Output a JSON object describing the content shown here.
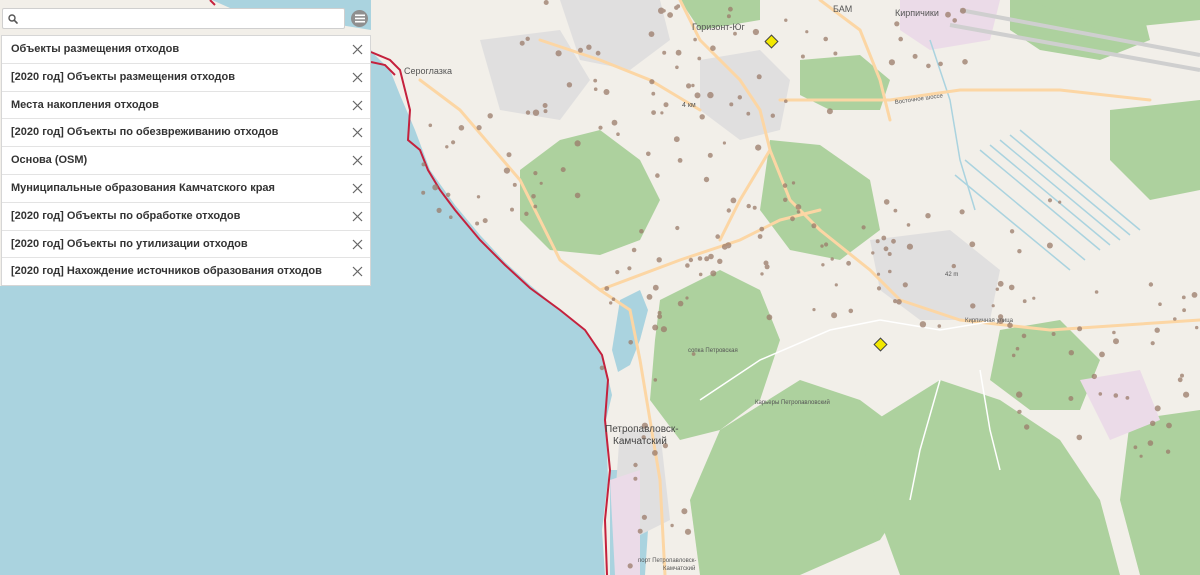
{
  "search": {
    "placeholder": ""
  },
  "layers": [
    {
      "label": "Объекты размещения отходов"
    },
    {
      "label": "[2020 год] Объекты размещения отходов"
    },
    {
      "label": "Места накопления отходов"
    },
    {
      "label": "[2020 год] Объекты по обезвреживанию отходов"
    },
    {
      "label": "Основа (OSM)"
    },
    {
      "label": "Муниципальные образования Камчатского края"
    },
    {
      "label": "[2020 год] Объекты по обработке отходов"
    },
    {
      "label": "[2020 год] Объекты по утилизации отходов"
    },
    {
      "label": "[2020 год] Нахождение источников образования отходов"
    }
  ],
  "map": {
    "labels": {
      "seroglazka": "Сероглазка",
      "gorizont_yug": "Горизонт-Юг",
      "bam": "БАМ",
      "kirpichiki": "Кирпичики",
      "petropavlovsk_1": "Петропавловск-",
      "petropavlovsk_2": "Камчатский",
      "vostochnoe_shosse": "Восточное шоссе",
      "sopka_petrovskaya": "сопка Петровская",
      "port_1": "порт Петропавловск-",
      "port_2": "Камчатский",
      "karery": "Карьеры Петропавловский",
      "kirpichnaya": "Кирпичная улица",
      "marker_height": "42 m",
      "a_km": "4 км"
    },
    "colors": {
      "water": "#aad3df",
      "forest": "#add19e",
      "land": "#f2efe9",
      "residential": "#e0dfdf",
      "industrial": "#ebdbe8",
      "road_major": "#fcd6a4",
      "boundary": "#c4213d",
      "building": "#9b7b6a",
      "marker": "#f2e800"
    }
  }
}
